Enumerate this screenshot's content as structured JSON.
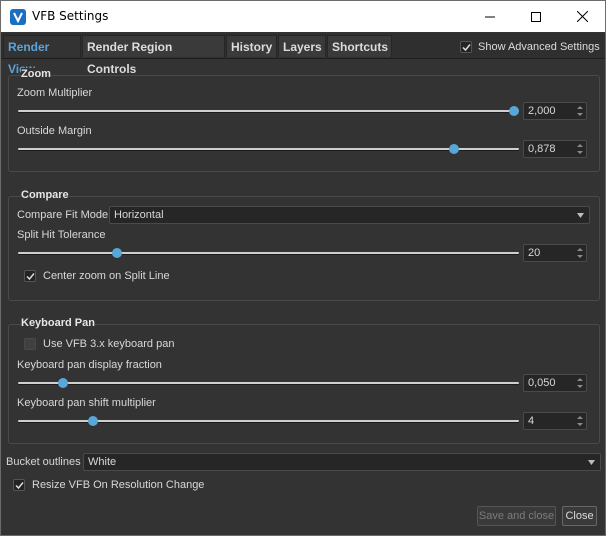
{
  "window": {
    "title": "VFB Settings"
  },
  "titlebar_buttons": [
    "minimize-icon",
    "maximize-icon",
    "close-icon"
  ],
  "tabs": [
    {
      "label": "Render View",
      "active": true
    },
    {
      "label": "Render Region Controls",
      "active": false
    },
    {
      "label": "History",
      "active": false
    },
    {
      "label": "Layers",
      "active": false
    },
    {
      "label": "Shortcuts",
      "active": false
    }
  ],
  "show_advanced": {
    "label": "Show Advanced Settings",
    "checked": true
  },
  "zoom": {
    "title": "Zoom",
    "multiplier": {
      "label": "Zoom Multiplier",
      "value": "2,000",
      "fraction": 0.99
    },
    "margin": {
      "label": "Outside Margin",
      "value": "0,878",
      "fraction": 0.878
    }
  },
  "compare": {
    "title": "Compare",
    "fit_mode": {
      "label": "Compare Fit Mode",
      "value": "Horizontal"
    },
    "split_tolerance": {
      "label": "Split Hit Tolerance",
      "value": "20",
      "fraction": 0.195
    },
    "center_zoom": {
      "label": "Center zoom on Split Line",
      "checked": true
    }
  },
  "keyboard_pan": {
    "title": "Keyboard Pan",
    "use_legacy": {
      "label": "Use VFB 3.x keyboard pan",
      "checked": false
    },
    "display_fraction": {
      "label": "Keyboard pan display fraction",
      "value": "0,050",
      "fraction": 0.09
    },
    "shift_multiplier": {
      "label": "Keyboard pan shift multiplier",
      "value": "4",
      "fraction": 0.148
    }
  },
  "bucket_outlines": {
    "label": "Bucket outlines",
    "value": "White"
  },
  "resize_on_change": {
    "label": "Resize VFB On Resolution Change",
    "checked": true
  },
  "buttons": {
    "save_close": "Save and close",
    "close": "Close"
  },
  "colors": {
    "accent": "#57a7d9",
    "tab_active": "#5ba3d9",
    "background": "#333333"
  }
}
